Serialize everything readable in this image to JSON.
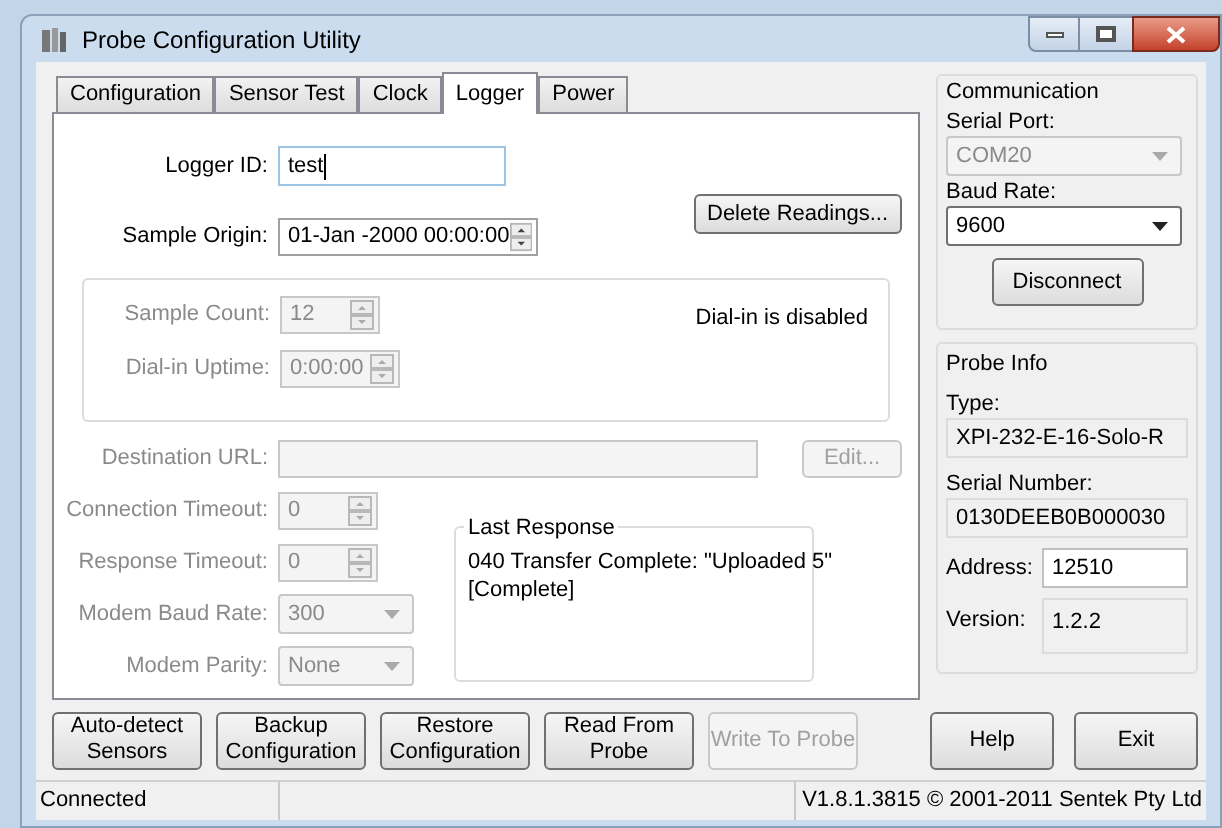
{
  "window": {
    "title": "Probe Configuration Utility"
  },
  "tabs": [
    {
      "label": "Configuration",
      "selected": false
    },
    {
      "label": "Sensor Test",
      "selected": false
    },
    {
      "label": "Clock",
      "selected": false
    },
    {
      "label": "Logger",
      "selected": true
    },
    {
      "label": "Power",
      "selected": false
    }
  ],
  "logger": {
    "logger_id": {
      "label": "Logger ID:",
      "value": "test"
    },
    "sample_origin": {
      "label": "Sample Origin:",
      "value": "01-Jan -2000 00:00:00"
    },
    "delete_button": {
      "label": "Delete Readings...",
      "disabled": false
    },
    "dial_in": {
      "fields": [
        {
          "label": "Sample Count:",
          "value": "12",
          "disabled": true
        },
        {
          "label": "Dial-in Uptime:",
          "value": "0:00:00",
          "disabled": true
        }
      ],
      "status": "Dial-in is disabled"
    },
    "destination_url": {
      "label": "Destination URL:",
      "disabled": true
    },
    "edit_button": {
      "label": "Edit...",
      "disabled": true
    },
    "modem_fields": [
      {
        "kind": "spinner",
        "label": "Connection Timeout:",
        "value": "0",
        "disabled": true
      },
      {
        "kind": "spinner",
        "label": "Response Timeout:",
        "value": "0",
        "disabled": true
      },
      {
        "kind": "dropdown",
        "label": "Modem Baud Rate:",
        "value": "300",
        "disabled": true
      },
      {
        "kind": "dropdown",
        "label": "Modem Parity:",
        "value": "None",
        "disabled": true
      }
    ],
    "last_response": {
      "title": "Last Response",
      "lines": [
        "040 Transfer Complete: \"Uploaded 5\"",
        "[Complete]"
      ]
    }
  },
  "communication": {
    "title": "Communication",
    "serial_port": {
      "label": "Serial Port:",
      "value": "COM20",
      "disabled": true
    },
    "baud_rate": {
      "label": "Baud Rate:",
      "value": "9600",
      "disabled": false
    },
    "disconnect_button": {
      "label": "Disconnect"
    }
  },
  "probe_info": {
    "title": "Probe Info",
    "type": {
      "label": "Type:",
      "value": "XPI-232-E-16-Solo-R"
    },
    "serial_number": {
      "label": "Serial Number:",
      "value": "0130DEEB0B000030"
    },
    "address": {
      "label": "Address:",
      "value": "12510"
    },
    "version": {
      "label": "Version:",
      "value": "1.2.2"
    }
  },
  "buttons": [
    {
      "label": "Auto-detect\nSensors",
      "disabled": false
    },
    {
      "label": "Backup\nConfiguration",
      "disabled": false
    },
    {
      "label": "Restore\nConfiguration",
      "disabled": false
    },
    {
      "label": "Read From\nProbe",
      "disabled": false
    },
    {
      "label": "Write To Probe",
      "disabled": true
    }
  ],
  "right_buttons": [
    {
      "label": "Help"
    },
    {
      "label": "Exit"
    }
  ],
  "status_bar": {
    "status": "Connected",
    "version": "V1.8.1.3815 © 2001-2011 Sentek Pty Ltd"
  }
}
